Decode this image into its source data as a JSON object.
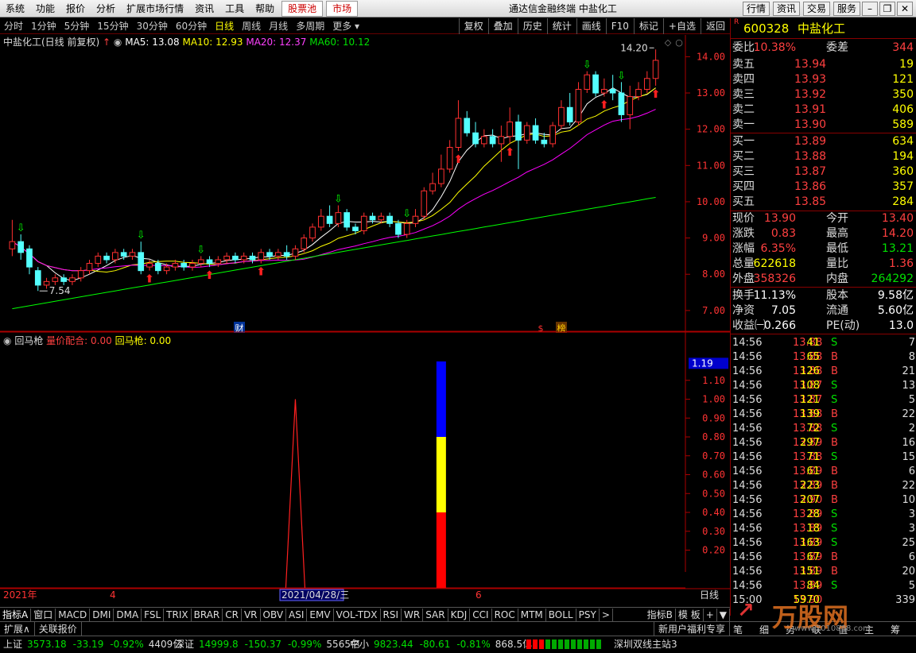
{
  "menu": {
    "items": [
      "系统",
      "功能",
      "报价",
      "分析",
      "扩展市场行情",
      "资讯",
      "工具",
      "帮助"
    ],
    "red_items": [
      "股票池",
      "市场"
    ],
    "title": "通达信金融终端  中盐化工",
    "right_buttons": [
      "行情",
      "资讯",
      "交易",
      "服务"
    ]
  },
  "periods": {
    "items": [
      "分时",
      "1分钟",
      "5分钟",
      "15分钟",
      "30分钟",
      "60分钟",
      "日线",
      "周线",
      "月线",
      "多周期",
      "更多"
    ],
    "active": "日线",
    "tools": [
      "复权",
      "叠加",
      "历史",
      "统计",
      "画线",
      "F10",
      "标记",
      "+自选",
      "返回"
    ]
  },
  "main_head": {
    "name": "中盐化工(日线 前复权)",
    "ma5": "MA5: 13.08",
    "ma10": "MA10: 12.93",
    "ma20": "MA20: 12.37",
    "ma60": "MA60: 10.12"
  },
  "sub_head": {
    "name": "回马枪",
    "v1": "量价配合: 0.00",
    "v2": "回马枪: 0.00",
    "cur": "1.19"
  },
  "chart_data": [
    {
      "type": "candlestick",
      "title": "中盐化工(日线 前复权)",
      "ylim": [
        6.8,
        14.6
      ],
      "yticks": [
        "14.00",
        "13.00",
        "12.00",
        "11.00",
        "10.00",
        "9.00",
        "8.00",
        "7.00"
      ],
      "high_label": "14.20",
      "low_label": "7.54",
      "xlabels": [
        "2021年",
        "4",
        "2021/04/28/三",
        "6"
      ],
      "period_label": "日线",
      "markers": [
        "财",
        "$",
        "榜"
      ],
      "series": [
        {
          "name": "MA5",
          "color": "#ffffff"
        },
        {
          "name": "MA10",
          "color": "#ffff00"
        },
        {
          "name": "MA20",
          "color": "#ff00ff"
        },
        {
          "name": "MA60",
          "color": "#00ff00"
        }
      ],
      "candles": [
        [
          8.7,
          8.9,
          8.5,
          9.5
        ],
        [
          8.9,
          8.6,
          8.4,
          9.1
        ],
        [
          8.7,
          8.2,
          8.0,
          8.8
        ],
        [
          8.1,
          7.7,
          7.54,
          8.2
        ],
        [
          7.7,
          7.8,
          7.6,
          7.9
        ],
        [
          7.8,
          7.9,
          7.7,
          8.0
        ],
        [
          7.9,
          7.8,
          7.7,
          8.0
        ],
        [
          7.8,
          7.9,
          7.7,
          8.0
        ],
        [
          7.9,
          8.1,
          7.8,
          8.2
        ],
        [
          8.1,
          8.3,
          8.0,
          8.4
        ],
        [
          8.3,
          8.5,
          8.2,
          8.6
        ],
        [
          8.5,
          8.4,
          8.3,
          8.6
        ],
        [
          8.4,
          8.6,
          8.3,
          8.7
        ],
        [
          8.6,
          8.5,
          8.4,
          8.7
        ],
        [
          8.5,
          8.6,
          8.4,
          8.7
        ],
        [
          8.6,
          8.1,
          8.0,
          8.9
        ],
        [
          8.2,
          8.3,
          8.1,
          8.4
        ],
        [
          8.3,
          8.1,
          8.0,
          8.4
        ],
        [
          8.1,
          8.2,
          8.0,
          8.3
        ],
        [
          8.2,
          8.3,
          8.1,
          8.4
        ],
        [
          8.3,
          8.2,
          8.1,
          8.4
        ],
        [
          8.2,
          8.3,
          8.1,
          8.4
        ],
        [
          8.3,
          8.4,
          8.2,
          8.5
        ],
        [
          8.4,
          8.3,
          8.2,
          8.5
        ],
        [
          8.3,
          8.4,
          8.2,
          8.5
        ],
        [
          8.4,
          8.5,
          8.3,
          8.6
        ],
        [
          8.5,
          8.4,
          8.3,
          8.6
        ],
        [
          8.4,
          8.5,
          8.3,
          8.6
        ],
        [
          8.5,
          8.4,
          8.3,
          8.6
        ],
        [
          8.4,
          8.6,
          8.3,
          8.7
        ],
        [
          8.6,
          8.5,
          8.4,
          8.7
        ],
        [
          8.5,
          8.6,
          8.4,
          8.7
        ],
        [
          8.6,
          8.5,
          8.4,
          8.8
        ],
        [
          8.5,
          8.7,
          8.4,
          8.8
        ],
        [
          8.7,
          9.0,
          8.6,
          9.1
        ],
        [
          9.0,
          9.3,
          8.9,
          9.4
        ],
        [
          9.3,
          9.6,
          9.2,
          9.8
        ],
        [
          9.6,
          9.4,
          9.3,
          9.9
        ],
        [
          9.4,
          9.7,
          9.3,
          9.9
        ],
        [
          9.7,
          9.3,
          9.2,
          9.8
        ],
        [
          9.3,
          9.2,
          9.1,
          9.4
        ],
        [
          9.2,
          9.6,
          9.1,
          9.7
        ],
        [
          9.6,
          9.5,
          9.4,
          9.7
        ],
        [
          9.5,
          9.6,
          9.4,
          9.7
        ],
        [
          9.6,
          9.4,
          9.3,
          9.7
        ],
        [
          9.4,
          9.1,
          9.0,
          9.5
        ],
        [
          9.1,
          9.4,
          9.0,
          9.5
        ],
        [
          9.4,
          9.6,
          9.3,
          9.8
        ],
        [
          9.6,
          10.3,
          9.5,
          10.4
        ],
        [
          10.3,
          10.5,
          10.2,
          10.8
        ],
        [
          10.5,
          10.9,
          10.4,
          11.3
        ],
        [
          10.9,
          11.5,
          10.8,
          11.7
        ],
        [
          11.5,
          12.3,
          11.4,
          12.8
        ],
        [
          12.3,
          11.9,
          11.8,
          12.5
        ],
        [
          11.9,
          11.6,
          11.5,
          12.2
        ],
        [
          11.6,
          11.8,
          11.5,
          12.0
        ],
        [
          11.8,
          11.6,
          11.5,
          12.0
        ],
        [
          11.6,
          11.8,
          11.1,
          12.1
        ],
        [
          11.8,
          12.2,
          11.6,
          12.6
        ],
        [
          12.2,
          11.7,
          10.9,
          12.4
        ],
        [
          11.7,
          12.1,
          11.6,
          12.2
        ],
        [
          12.1,
          11.7,
          11.6,
          12.3
        ],
        [
          11.7,
          11.6,
          11.5,
          11.9
        ],
        [
          11.6,
          12.1,
          11.5,
          12.2
        ],
        [
          12.1,
          12.6,
          12.0,
          12.8
        ],
        [
          12.6,
          12.2,
          12.1,
          13.0
        ],
        [
          12.2,
          13.1,
          12.1,
          13.3
        ],
        [
          13.1,
          13.5,
          13.0,
          13.6
        ],
        [
          13.5,
          13.0,
          12.9,
          13.6
        ],
        [
          13.0,
          13.1,
          12.9,
          13.4
        ],
        [
          13.1,
          13.0,
          12.8,
          13.5
        ],
        [
          13.0,
          12.4,
          12.2,
          13.3
        ],
        [
          12.4,
          12.9,
          12.0,
          13.2
        ],
        [
          12.9,
          13.1,
          12.8,
          13.3
        ],
        [
          13.1,
          13.4,
          13.0,
          13.6
        ],
        [
          13.4,
          13.9,
          13.2,
          14.2
        ]
      ]
    },
    {
      "type": "bar",
      "title": "回马枪",
      "ylim": [
        0,
        1.28
      ],
      "yticks": [
        "1.10",
        "1.00",
        "0.90",
        "0.80",
        "0.70",
        "0.60",
        "0.50",
        "0.40",
        "0.30",
        "0.20"
      ],
      "spike_value": 1.0,
      "stacked_bar": [
        {
          "color": "#ff0000",
          "value": 0.4
        },
        {
          "color": "#ffff00",
          "value": 0.4
        },
        {
          "color": "#0000ff",
          "value": 0.4
        }
      ]
    }
  ],
  "quote": {
    "code": "600328",
    "name": "中盐化工",
    "weibi": "10.38%",
    "weicha": "344",
    "asks": [
      [
        "卖五",
        "13.94",
        "19"
      ],
      [
        "卖四",
        "13.93",
        "121"
      ],
      [
        "卖三",
        "13.92",
        "350"
      ],
      [
        "卖二",
        "13.91",
        "406"
      ],
      [
        "卖一",
        "13.90",
        "589"
      ]
    ],
    "bids": [
      [
        "买一",
        "13.89",
        "634"
      ],
      [
        "买二",
        "13.88",
        "194"
      ],
      [
        "买三",
        "13.87",
        "360"
      ],
      [
        "买四",
        "13.86",
        "357"
      ],
      [
        "买五",
        "13.85",
        "284"
      ]
    ],
    "stats": [
      [
        "现价",
        "13.90",
        "今开",
        "13.40"
      ],
      [
        "涨跌",
        "0.83",
        "最高",
        "14.20"
      ],
      [
        "涨幅",
        "6.35%",
        "最低",
        "13.21"
      ],
      [
        "总量",
        "622618",
        "量比",
        "1.36"
      ],
      [
        "外盘",
        "358326",
        "内盘",
        "264292"
      ],
      [
        "换手",
        "11.13%",
        "股本",
        "9.58亿"
      ],
      [
        "净资",
        "7.05",
        "流通",
        "5.60亿"
      ],
      [
        "收益㈠",
        "0.266",
        "PE(动)",
        "13.0"
      ]
    ]
  },
  "trades": [
    [
      "14:56",
      "13.88",
      "41",
      "S",
      "7"
    ],
    [
      "14:56",
      "13.88",
      "65",
      "B",
      "8"
    ],
    [
      "14:56",
      "13.88",
      "126",
      "B",
      "21"
    ],
    [
      "14:56",
      "13.87",
      "108",
      "S",
      "13"
    ],
    [
      "14:56",
      "13.87",
      "121",
      "S",
      "5"
    ],
    [
      "14:56",
      "13.88",
      "139",
      "B",
      "22"
    ],
    [
      "14:56",
      "13.88",
      "72",
      "S",
      "2"
    ],
    [
      "14:56",
      "13.89",
      "297",
      "B",
      "16"
    ],
    [
      "14:56",
      "13.88",
      "71",
      "S",
      "15"
    ],
    [
      "14:56",
      "13.89",
      "61",
      "B",
      "6"
    ],
    [
      "14:56",
      "13.89",
      "223",
      "B",
      "22"
    ],
    [
      "14:56",
      "13.90",
      "207",
      "B",
      "10"
    ],
    [
      "14:56",
      "13.89",
      "28",
      "S",
      "3"
    ],
    [
      "14:56",
      "13.89",
      "18",
      "S",
      "3"
    ],
    [
      "14:56",
      "13.89",
      "163",
      "S",
      "25"
    ],
    [
      "14:56",
      "13.89",
      "67",
      "B",
      "6"
    ],
    [
      "14:56",
      "13.89",
      "151",
      "B",
      "20"
    ],
    [
      "14:56",
      "13.89",
      "84",
      "S",
      "5"
    ],
    [
      "15:00",
      "13.90",
      "5970",
      "",
      "339"
    ]
  ],
  "indicator_tabs": [
    "指标A",
    "窗口",
    "MACD",
    "DMI",
    "DMA",
    "FSL",
    "TRIX",
    "BRAR",
    "CR",
    "VR",
    "OBV",
    "ASI",
    "EMV",
    "VOL-TDX",
    "RSI",
    "WR",
    "SAR",
    "KDJ",
    "CCI",
    "ROC",
    "MTM",
    "BOLL",
    "PSY"
  ],
  "indicator_right": [
    "指标B",
    "模 板",
    "+",
    "▼"
  ],
  "status1": [
    "扩展∧",
    "关联报价"
  ],
  "status1_right": "新用户福利专享",
  "right_tabs": [
    "笔",
    "细",
    "势",
    "联",
    "值",
    "主",
    "筹"
  ],
  "index": [
    {
      "name": "上证",
      "price": "3573.18",
      "chg": "-33.19",
      "pct": "-0.92%",
      "amt": "4409亿"
    },
    {
      "name": "深证",
      "price": "14999.8",
      "chg": "-150.37",
      "pct": "-0.99%",
      "amt": "5565亿"
    },
    {
      "name": "中小",
      "price": "9823.44",
      "chg": "-80.61",
      "pct": "-0.81%",
      "amt": "868.5亿"
    }
  ],
  "server": "深圳双线主站3",
  "watermark": "万股网",
  "watermark_url": "www.2010888.com"
}
